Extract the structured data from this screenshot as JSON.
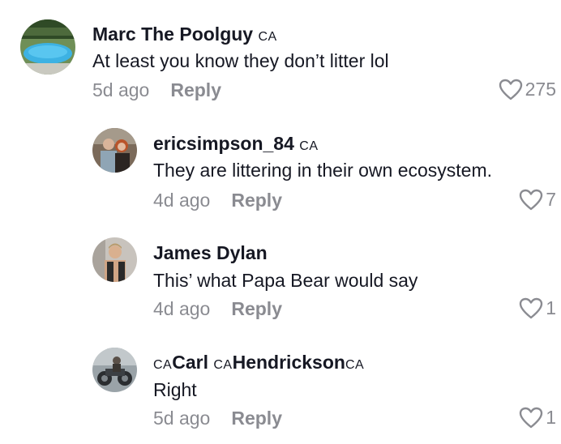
{
  "comments": [
    {
      "author": "Marc The Poolguy",
      "author_suffix": "CA",
      "text": "At least you know they don’t litter lol",
      "time": "5d ago",
      "reply_label": "Reply",
      "likes": "275",
      "avatar_icon": "pool-photo"
    },
    {
      "author_prefix": "",
      "author": "ericsimpson_84",
      "author_suffix": "CA",
      "text": "They are littering in their own ecosystem.",
      "time": "4d ago",
      "reply_label": "Reply",
      "likes": "7",
      "avatar_icon": "couple-photo"
    },
    {
      "author": "James Dylan",
      "text": "This’ what Papa Bear would say",
      "time": "4d ago",
      "reply_label": "Reply",
      "likes": "1",
      "avatar_icon": "selfie-photo"
    },
    {
      "author_prefix": "CA",
      "author_mid1": "Carl ",
      "author_mid_tag": "CA",
      "author_mid2": "Hendrickson",
      "author_suffix": "CA",
      "text": "Right",
      "time": "5d ago",
      "reply_label": "Reply",
      "likes": "1",
      "avatar_icon": "motorcycle-photo"
    }
  ],
  "colors": {
    "text": "#161823",
    "muted": "#8a8b91",
    "background": "#ffffff"
  }
}
